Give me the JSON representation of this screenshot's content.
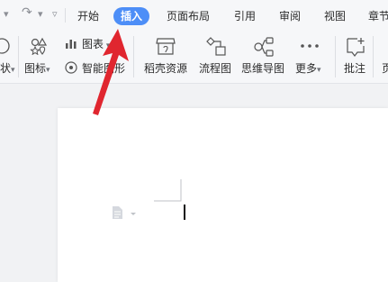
{
  "quick_access": {
    "redo_icon": "redo-icon",
    "more_icon": "chevron-down-icon"
  },
  "tabs": [
    {
      "label": "开始",
      "active": false
    },
    {
      "label": "插入",
      "active": true
    },
    {
      "label": "页面布局",
      "active": false
    },
    {
      "label": "引用",
      "active": false
    },
    {
      "label": "审阅",
      "active": false
    },
    {
      "label": "视图",
      "active": false
    },
    {
      "label": "章节",
      "active": false
    }
  ],
  "ribbon": {
    "shape_label_partial": "状",
    "icons_label": "图标",
    "chart_label": "图表",
    "smart_shape_label": "智能图形",
    "template_label": "稻壳资源",
    "flowchart_label": "流程图",
    "mindmap_label": "思维导图",
    "more_label": "更多",
    "comment_label": "批注",
    "cut_label": "页"
  },
  "annotation": {
    "arrow_color": "#e0262f"
  },
  "colors": {
    "accent": "#4d8ef7",
    "arrow": "#e0262f"
  }
}
